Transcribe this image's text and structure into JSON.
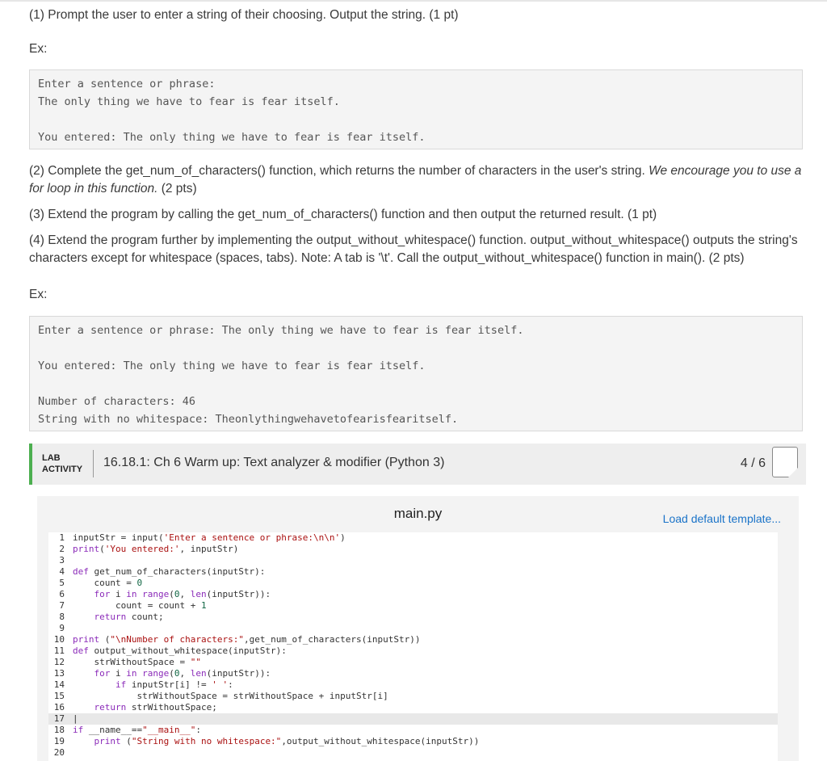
{
  "step1": "(1) Prompt the user to enter a string of their choosing. Output the string. (1 pt)",
  "ex1_label": "Ex:",
  "sample1": [
    "Enter a sentence or phrase:",
    "The only thing we have to fear is fear itself.",
    "",
    "You entered: The only thing we have to fear is fear itself."
  ],
  "step2_main": "(2) Complete the get_num_of_characters() function, which returns the number of characters in the user's string. ",
  "step2_em": "We encourage you to use a for loop in this function.",
  "step2_pts": " (2 pts)",
  "step3": "(3) Extend the program by calling the get_num_of_characters() function and then output the returned result. (1 pt)",
  "step4": "(4) Extend the program further by implementing the output_without_whitespace() function. output_without_whitespace() outputs the string's characters except for whitespace (spaces, tabs). Note: A tab is '\\t'. Call the output_without_whitespace() function in main(). (2 pts)",
  "ex2_label": "Ex:",
  "sample2": [
    "Enter a sentence or phrase: The only thing we have to fear is fear itself.",
    "",
    "You entered: The only thing we have to fear is fear itself.",
    "",
    "Number of characters: 46",
    "String with no whitespace: Theonlythingwehavetofearisfearitself."
  ],
  "lab": {
    "tag_line1": "LAB",
    "tag_line2": "ACTIVITY",
    "title": "16.18.1: Ch 6 Warm up: Text analyzer & modifier (Python 3)",
    "score": "4 / 6"
  },
  "editor": {
    "filename": "main.py",
    "load_default": "Load default template...",
    "lines": [
      {
        "n": "1",
        "html": "inputStr = input(<span class=\"str\">'Enter a sentence or phrase:\\n\\n'</span>)"
      },
      {
        "n": "2",
        "html": "<span class=\"kw\">print</span>(<span class=\"str\">'You entered:'</span>, inputStr)"
      },
      {
        "n": "3",
        "html": ""
      },
      {
        "n": "4",
        "html": "<span class=\"kw\">def</span> get_num_of_characters(inputStr):"
      },
      {
        "n": "5",
        "html": "    count = <span class=\"numc\">0</span>"
      },
      {
        "n": "6",
        "html": "    <span class=\"kw\">for</span> i <span class=\"kw\">in</span> <span class=\"kw\">range</span>(<span class=\"numc\">0</span>, <span class=\"kw\">len</span>(inputStr)):"
      },
      {
        "n": "7",
        "html": "        count = count + <span class=\"numc\">1</span>"
      },
      {
        "n": "8",
        "html": "    <span class=\"kw\">return</span> count;"
      },
      {
        "n": "9",
        "html": ""
      },
      {
        "n": "10",
        "html": "<span class=\"kw\">print</span> (<span class=\"str\">\"\\nNumber of characters:\"</span>,get_num_of_characters(inputStr))"
      },
      {
        "n": "11",
        "html": "<span class=\"kw\">def</span> output_without_whitespace(inputStr):"
      },
      {
        "n": "12",
        "html": "    strWithoutSpace = <span class=\"str\">\"\"</span>"
      },
      {
        "n": "13",
        "html": "    <span class=\"kw\">for</span> i <span class=\"kw\">in</span> <span class=\"kw\">range</span>(<span class=\"numc\">0</span>, <span class=\"kw\">len</span>(inputStr)):"
      },
      {
        "n": "14",
        "html": "        <span class=\"kw\">if</span> inputStr[i] != <span class=\"str\">' '</span>:"
      },
      {
        "n": "15",
        "html": "            strWithoutSpace = strWithoutSpace + inputStr[i]"
      },
      {
        "n": "16",
        "html": "    <span class=\"kw\">return</span> strWithoutSpace;"
      },
      {
        "n": "17",
        "html": "|"
      },
      {
        "n": "18",
        "html": "<span class=\"kw\">if</span> __name__==<span class=\"str\">\"__main__\"</span>:"
      },
      {
        "n": "19",
        "html": "    <span class=\"kw\">print</span> (<span class=\"str\">\"String with no whitespace:\"</span>,output_without_whitespace(inputStr))"
      },
      {
        "n": "20",
        "html": ""
      }
    ]
  }
}
